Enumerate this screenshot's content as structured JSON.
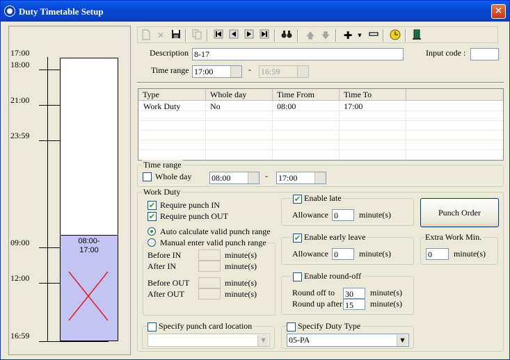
{
  "window": {
    "title": "Duty Timetable Setup",
    "close_glyph": "✕"
  },
  "timeline": {
    "labels": [
      "17:00",
      "18:00",
      "21:00",
      "23:59",
      "09:00",
      "12:00",
      "16:59"
    ],
    "duty_block_label": "08:00-\n17:00"
  },
  "toolbar": {
    "icons": [
      "new-icon",
      "delete-icon",
      "save-icon",
      "copy-icon",
      "first-icon",
      "prev-icon",
      "next-icon",
      "last-icon",
      "find-icon",
      "up-icon",
      "down-icon",
      "add-icon",
      "remove-icon",
      "clock-icon",
      "exit-icon"
    ]
  },
  "form": {
    "description_label": "Description",
    "description_value": "8-17",
    "time_range_label": "Time range",
    "time_from": "17:00",
    "time_dash": "-",
    "time_to": "16:59",
    "input_code_label": "Input code :",
    "input_code_value": ""
  },
  "table": {
    "columns": [
      "Type",
      "Whole day",
      "Time From",
      "Time To"
    ],
    "rows": [
      {
        "type": "Work Duty",
        "whole_day": "No",
        "time_from": "08:00",
        "time_to": "17:00"
      }
    ]
  },
  "time_range_group": {
    "title": "Time range",
    "whole_day_label": "Whole day",
    "from": "08:00",
    "dash": "-",
    "to": "17:00"
  },
  "work_duty": {
    "title": "Work Duty",
    "require_in": "Require punch IN",
    "require_out": "Require punch OUT",
    "auto_calc": "Auto calculate valid punch range",
    "manual": "Manual enter valid punch range",
    "before_in": "Before IN",
    "after_in": "After IN",
    "before_out": "Before OUT",
    "after_out": "After OUT",
    "minutes": "minute(s)"
  },
  "late": {
    "label": "Enable late",
    "allowance_label": "Allowance",
    "allowance": "0",
    "unit": "minute(s)"
  },
  "early": {
    "label": "Enable early leave",
    "allowance_label": "Allowance",
    "allowance": "0",
    "unit": "minute(s)"
  },
  "roundoff": {
    "label": "Enable round-off",
    "off_label": "Round off to",
    "off_value": "30",
    "up_label": "Round up after",
    "up_value": "15",
    "unit": "minute(s)"
  },
  "punch_order_label": "Punch Order",
  "extra_work": {
    "title": "Extra Work Min.",
    "value": "0",
    "unit": "minute(s)"
  },
  "punch_card": {
    "label": "Specify punch card location",
    "value": ""
  },
  "duty_type": {
    "label": "Specify Duty Type",
    "value": "05-PA"
  }
}
